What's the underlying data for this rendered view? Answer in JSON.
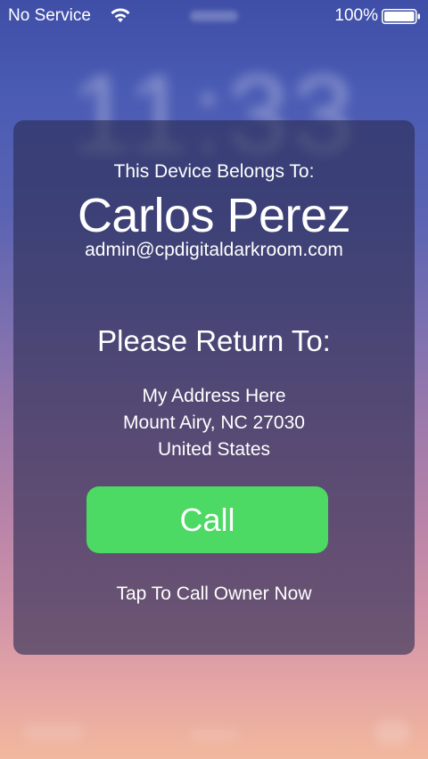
{
  "status_bar": {
    "carrier": "No Service",
    "battery_percent": "100%",
    "wifi_icon": "wifi-icon",
    "battery_icon": "battery-full-icon"
  },
  "background": {
    "clock": "11:33"
  },
  "card": {
    "belongs_label": "This Device Belongs To:",
    "owner_name": "Carlos Perez",
    "owner_email": "admin@cpdigitaldarkroom.com",
    "return_label": "Please Return To:",
    "address_lines": [
      "My Address Here",
      "Mount Airy, NC 27030",
      "United States"
    ],
    "call_button_label": "Call",
    "call_hint": "Tap To Call Owner Now"
  },
  "colors": {
    "call_button": "#4cd964",
    "card_background": "rgba(42,44,82,0.62)",
    "text": "#ffffff"
  }
}
